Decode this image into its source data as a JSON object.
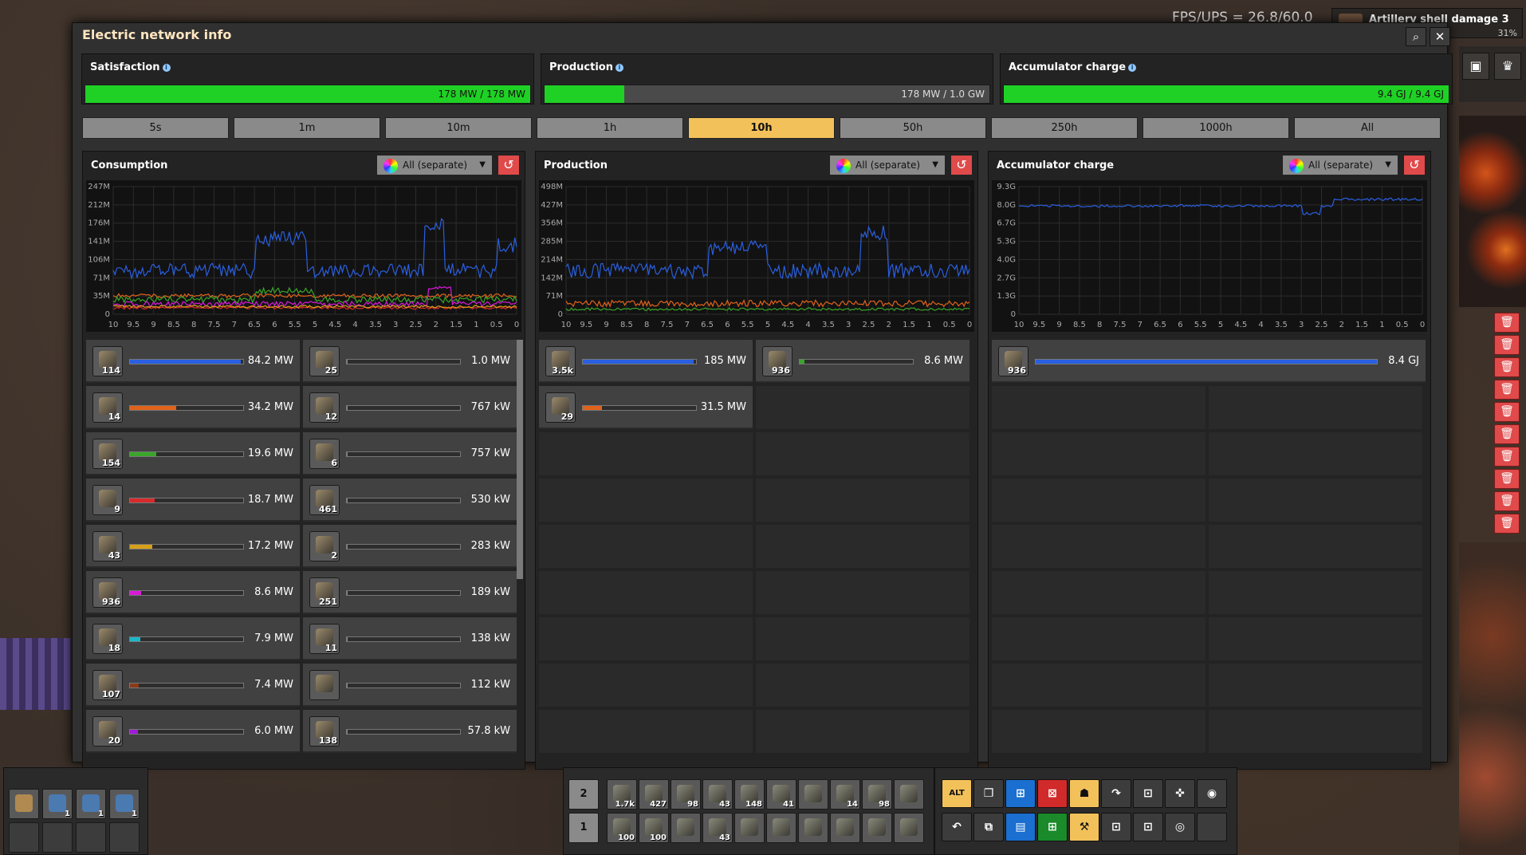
{
  "window": {
    "title": "Electric network info",
    "search_icon": "⌕",
    "close_icon": "✕"
  },
  "hud": {
    "fps": "FPS/UPS = 26.8/60.0",
    "tech": "Artillery shell damage 3",
    "tech_pct": "31%"
  },
  "top": {
    "satisfaction": {
      "label": "Satisfaction",
      "value": "178 MW / 178 MW",
      "fill": 1.0
    },
    "production": {
      "label": "Production",
      "value": "178 MW / 1.0 GW",
      "fill": 0.18
    },
    "accumulator": {
      "label": "Accumulator charge",
      "value": "9.4 GJ / 9.4 GJ",
      "fill": 1.0
    }
  },
  "tabs": [
    "5s",
    "1m",
    "10m",
    "1h",
    "10h",
    "50h",
    "250h",
    "1000h",
    "All"
  ],
  "selected_tab": "10h",
  "dropdown_label": "All (separate)",
  "colors": {
    "accent": "#f3c15a",
    "green": "#1fd124",
    "reset": "#e04a4a"
  },
  "consumption": {
    "title": "Consumption",
    "yticks": [
      "247M",
      "212M",
      "176M",
      "141M",
      "106M",
      "71M",
      "35M",
      "0"
    ],
    "xticks": [
      "10",
      "9.5",
      "9",
      "8.5",
      "8",
      "7.5",
      "7",
      "6.5",
      "6",
      "5.5",
      "5",
      "4.5",
      "4",
      "3.5",
      "3",
      "2.5",
      "2",
      "1.5",
      "1",
      "0.5",
      "0"
    ],
    "rows": [
      {
        "icon": "assembler-icon",
        "count": "114",
        "value": "84.2 MW",
        "fill": 0.98,
        "color": "#2a5fe0"
      },
      {
        "icon": "mining-drill-icon",
        "count": "25",
        "value": "1.0 MW",
        "fill": 0.01,
        "color": "#888"
      },
      {
        "icon": "lab-icon",
        "count": "14",
        "value": "34.2 MW",
        "fill": 0.41,
        "color": "#e0621a"
      },
      {
        "icon": "pump-icon",
        "count": "12",
        "value": "767 kW",
        "fill": 0.01,
        "color": "#888"
      },
      {
        "icon": "electric-drill-icon",
        "count": "154",
        "value": "19.6 MW",
        "fill": 0.23,
        "color": "#3aa52a"
      },
      {
        "icon": "electric-drill-icon",
        "count": "6",
        "value": "757 kW",
        "fill": 0.01,
        "color": "#888"
      },
      {
        "icon": "furnace-icon",
        "count": "9",
        "value": "18.7 MW",
        "fill": 0.22,
        "color": "#d82a2a"
      },
      {
        "icon": "inserter-icon",
        "count": "461",
        "value": "530 kW",
        "fill": 0.01,
        "color": "#888"
      },
      {
        "icon": "radar-icon",
        "count": "43",
        "value": "17.2 MW",
        "fill": 0.2,
        "color": "#d8a01a"
      },
      {
        "icon": "turret-icon",
        "count": "2",
        "value": "283 kW",
        "fill": 0.01,
        "color": "#888"
      },
      {
        "icon": "accumulator-icon",
        "count": "936",
        "value": "8.6 MW",
        "fill": 0.1,
        "color": "#d81ad8"
      },
      {
        "icon": "fast-inserter-icon",
        "count": "251",
        "value": "189 kW",
        "fill": 0.01,
        "color": "#888"
      },
      {
        "icon": "radar-icon",
        "count": "18",
        "value": "7.9 MW",
        "fill": 0.09,
        "color": "#1ab8c8"
      },
      {
        "icon": "roboport-icon",
        "count": "11",
        "value": "138 kW",
        "fill": 0.01,
        "color": "#888"
      },
      {
        "icon": "refinery-icon",
        "count": "107",
        "value": "7.4 MW",
        "fill": 0.08,
        "color": "#8a3a1a"
      },
      {
        "icon": "turret-icon",
        "count": "",
        "value": "112 kW",
        "fill": 0.01,
        "color": "#888"
      },
      {
        "icon": "beacon-icon",
        "count": "20",
        "value": "6.0 MW",
        "fill": 0.07,
        "color": "#a01ad8"
      },
      {
        "icon": "long-inserter-icon",
        "count": "138",
        "value": "57.8 kW",
        "fill": 0.01,
        "color": "#888"
      }
    ]
  },
  "production": {
    "title": "Production",
    "yticks": [
      "498M",
      "427M",
      "356M",
      "285M",
      "214M",
      "142M",
      "71M",
      "0"
    ],
    "xticks": [
      "10",
      "9.5",
      "9",
      "8.5",
      "8",
      "7.5",
      "7",
      "6.5",
      "6",
      "5.5",
      "5",
      "4.5",
      "4",
      "3.5",
      "3",
      "2.5",
      "2",
      "1.5",
      "1",
      "0.5",
      "0"
    ],
    "rows": [
      {
        "icon": "solar-panel-icon",
        "count": "3.5k",
        "value": "185 MW",
        "fill": 0.98,
        "color": "#2a5fe0"
      },
      {
        "icon": "accumulator-icon",
        "count": "936",
        "value": "8.6 MW",
        "fill": 0.04,
        "color": "#3aa52a"
      },
      {
        "icon": "steam-turbine-icon",
        "count": "29",
        "value": "31.5 MW",
        "fill": 0.17,
        "color": "#e0621a"
      }
    ]
  },
  "accumulator": {
    "title": "Accumulator charge",
    "yticks": [
      "9.3G",
      "8.0G",
      "6.7G",
      "5.3G",
      "4.0G",
      "2.7G",
      "1.3G",
      "0"
    ],
    "xticks": [
      "10",
      "9.5",
      "9",
      "8.5",
      "8",
      "7.5",
      "7",
      "6.5",
      "6",
      "5.5",
      "5",
      "4.5",
      "4",
      "3.5",
      "3",
      "2.5",
      "2",
      "1.5",
      "1",
      "0.5",
      "0"
    ],
    "rows": [
      {
        "icon": "accumulator-icon",
        "count": "936",
        "value": "8.4 GJ",
        "fill": 1.0,
        "color": "#2a5fe0"
      }
    ]
  },
  "hotbar": {
    "left": [
      {
        "count": ""
      },
      {
        "count": "1"
      },
      {
        "count": "1"
      },
      {
        "count": "1"
      }
    ],
    "rows": [
      "2",
      "1"
    ],
    "top": [
      "1.7k",
      "427",
      "98",
      "43",
      "148",
      "41",
      "",
      "14",
      "98",
      ""
    ],
    "bottom": [
      "100",
      "100",
      "",
      "43",
      "",
      "",
      "",
      "",
      "",
      ""
    ]
  }
}
